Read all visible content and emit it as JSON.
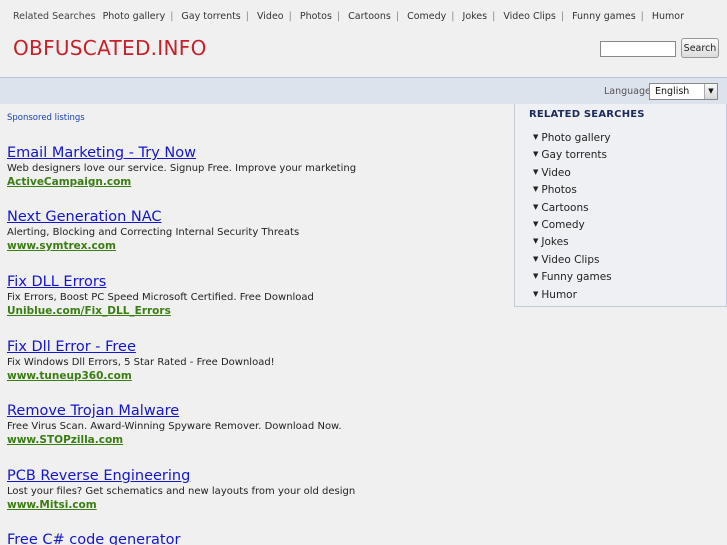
{
  "topnav": {
    "label": "Related Searches",
    "links": [
      "Photo gallery",
      "Gay torrents",
      "Video",
      "Photos",
      "Cartoons",
      "Comedy",
      "Jokes",
      "Video Clips",
      "Funny games",
      "Humor"
    ],
    "separator": "|"
  },
  "brand": {
    "name": "OBFUSCATED.INFO"
  },
  "search": {
    "value": "",
    "button_label": "Search"
  },
  "language": {
    "label": "Language:",
    "selected": "English",
    "arrow": "▼"
  },
  "main": {
    "sponsored_label": "Sponsored listings",
    "listings": [
      {
        "title": "Email Marketing - Try Now",
        "description": "Web designers love our service. Signup Free. Improve your marketing",
        "url": "ActiveCampaign.com"
      },
      {
        "title": "Next Generation NAC",
        "description": "Alerting, Blocking and Correcting Internal Security Threats",
        "url": "www.symtrex.com"
      },
      {
        "title": "Fix DLL Errors",
        "description": "Fix Errors, Boost PC Speed Microsoft Certified. Free Download",
        "url": "Uniblue.com/Fix_DLL_Errors"
      },
      {
        "title": "Fix Dll Error - Free",
        "description": "Fix Windows Dll Errors, 5 Star Rated - Free Download!",
        "url": "www.tuneup360.com"
      },
      {
        "title": "Remove Trojan Malware",
        "description": "Free Virus Scan. Award-Winning Spyware Remover. Download Now.",
        "url": "www.STOPzilla.com"
      },
      {
        "title": "PCB Reverse Engineering",
        "description": "Lost your files? Get schematics and new layouts from your old design",
        "url": "www.Mitsi.com"
      },
      {
        "title": "Free C# code generator",
        "description": "",
        "url": ""
      }
    ]
  },
  "related": {
    "heading": "RELATED SEARCHES",
    "bullet": "▼",
    "items": [
      "Photo gallery",
      "Gay torrents",
      "Video",
      "Photos",
      "Cartoons",
      "Comedy",
      "Jokes",
      "Video Clips",
      "Funny games",
      "Humor"
    ]
  },
  "colors": {
    "brand": "#c8202a",
    "link": "#1515cc",
    "url": "#3a7d12",
    "langbar": "#dde3ed"
  }
}
